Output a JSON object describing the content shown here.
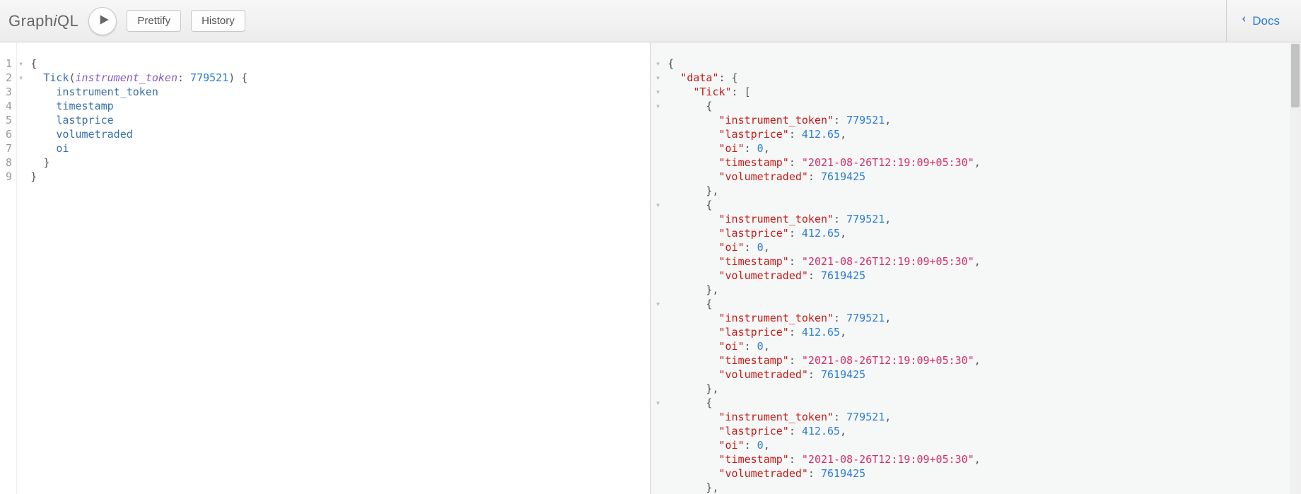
{
  "header": {
    "title_prefix": "Graph",
    "title_i": "i",
    "title_suffix": "QL",
    "prettify": "Prettify",
    "history": "History",
    "docs": "Docs"
  },
  "query": {
    "line_numbers": [
      "1",
      "2",
      "3",
      "4",
      "5",
      "6",
      "7",
      "8",
      "9"
    ],
    "fold_marks": [
      "▾",
      "▾",
      "",
      "",
      "",
      "",
      "",
      "",
      ""
    ],
    "field_name": "Tick",
    "arg_name": "instrument_token",
    "arg_value": "779521",
    "sel1": "instrument_token",
    "sel2": "timestamp",
    "sel3": "lastprice",
    "sel4": "volumetraded",
    "sel5": "oi"
  },
  "result": {
    "root_key": "data",
    "list_key": "Tick",
    "items": [
      {
        "instrument_token": 779521,
        "lastprice": 412.65,
        "oi": 0,
        "timestamp": "2021-08-26T12:19:09+05:30",
        "volumetraded": 7619425
      },
      {
        "instrument_token": 779521,
        "lastprice": 412.65,
        "oi": 0,
        "timestamp": "2021-08-26T12:19:09+05:30",
        "volumetraded": 7619425
      },
      {
        "instrument_token": 779521,
        "lastprice": 412.65,
        "oi": 0,
        "timestamp": "2021-08-26T12:19:09+05:30",
        "volumetraded": 7619425
      },
      {
        "instrument_token": 779521,
        "lastprice": 412.65,
        "oi": 0,
        "timestamp": "2021-08-26T12:19:09+05:30",
        "volumetraded": 7619425
      }
    ],
    "keys": {
      "instrument_token": "instrument_token",
      "lastprice": "lastprice",
      "oi": "oi",
      "timestamp": "timestamp",
      "volumetraded": "volumetraded"
    }
  }
}
